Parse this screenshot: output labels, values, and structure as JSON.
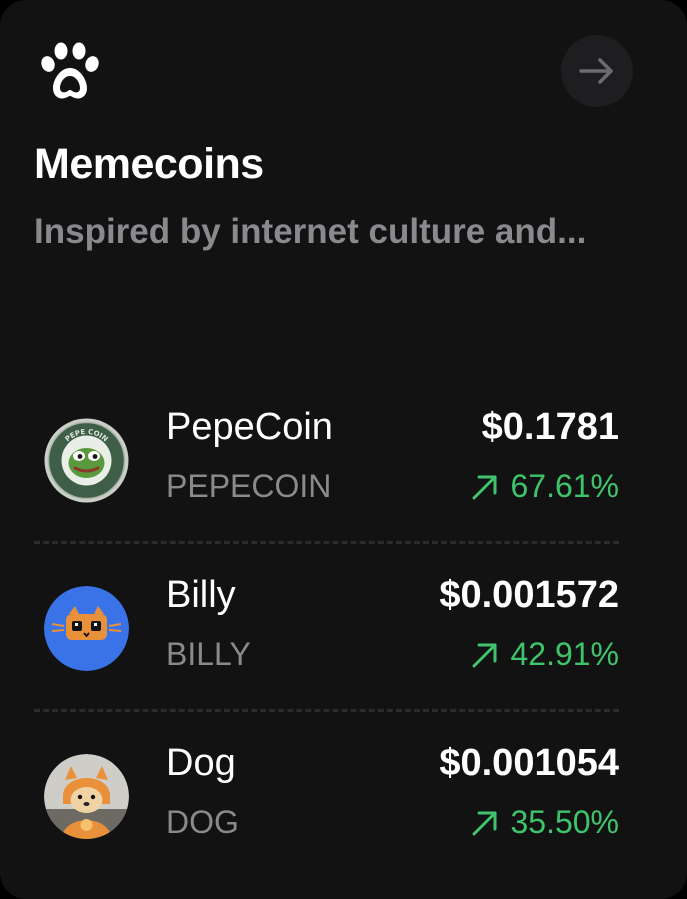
{
  "card": {
    "title": "Memecoins",
    "subtitle": "Inspired by internet culture and...",
    "icon": "paw-icon",
    "action_icon": "arrow-right-icon"
  },
  "coins": [
    {
      "name": "PepeCoin",
      "symbol": "PEPECOIN",
      "price": "$0.1781",
      "change": "67.61%",
      "trend_icon": "arrow-up-right-icon",
      "logo_text": "PEPE COIN"
    },
    {
      "name": "Billy",
      "symbol": "BILLY",
      "price": "$0.001572",
      "change": "42.91%",
      "trend_icon": "arrow-up-right-icon"
    },
    {
      "name": "Dog",
      "symbol": "DOG",
      "price": "$0.001054",
      "change": "35.50%",
      "trend_icon": "arrow-up-right-icon"
    }
  ],
  "colors": {
    "background": "#121213",
    "positive": "#3ec56b",
    "muted_text": "#8a8a8e",
    "billy_blue": "#3a73e8",
    "dog_orange": "#e8913a"
  }
}
